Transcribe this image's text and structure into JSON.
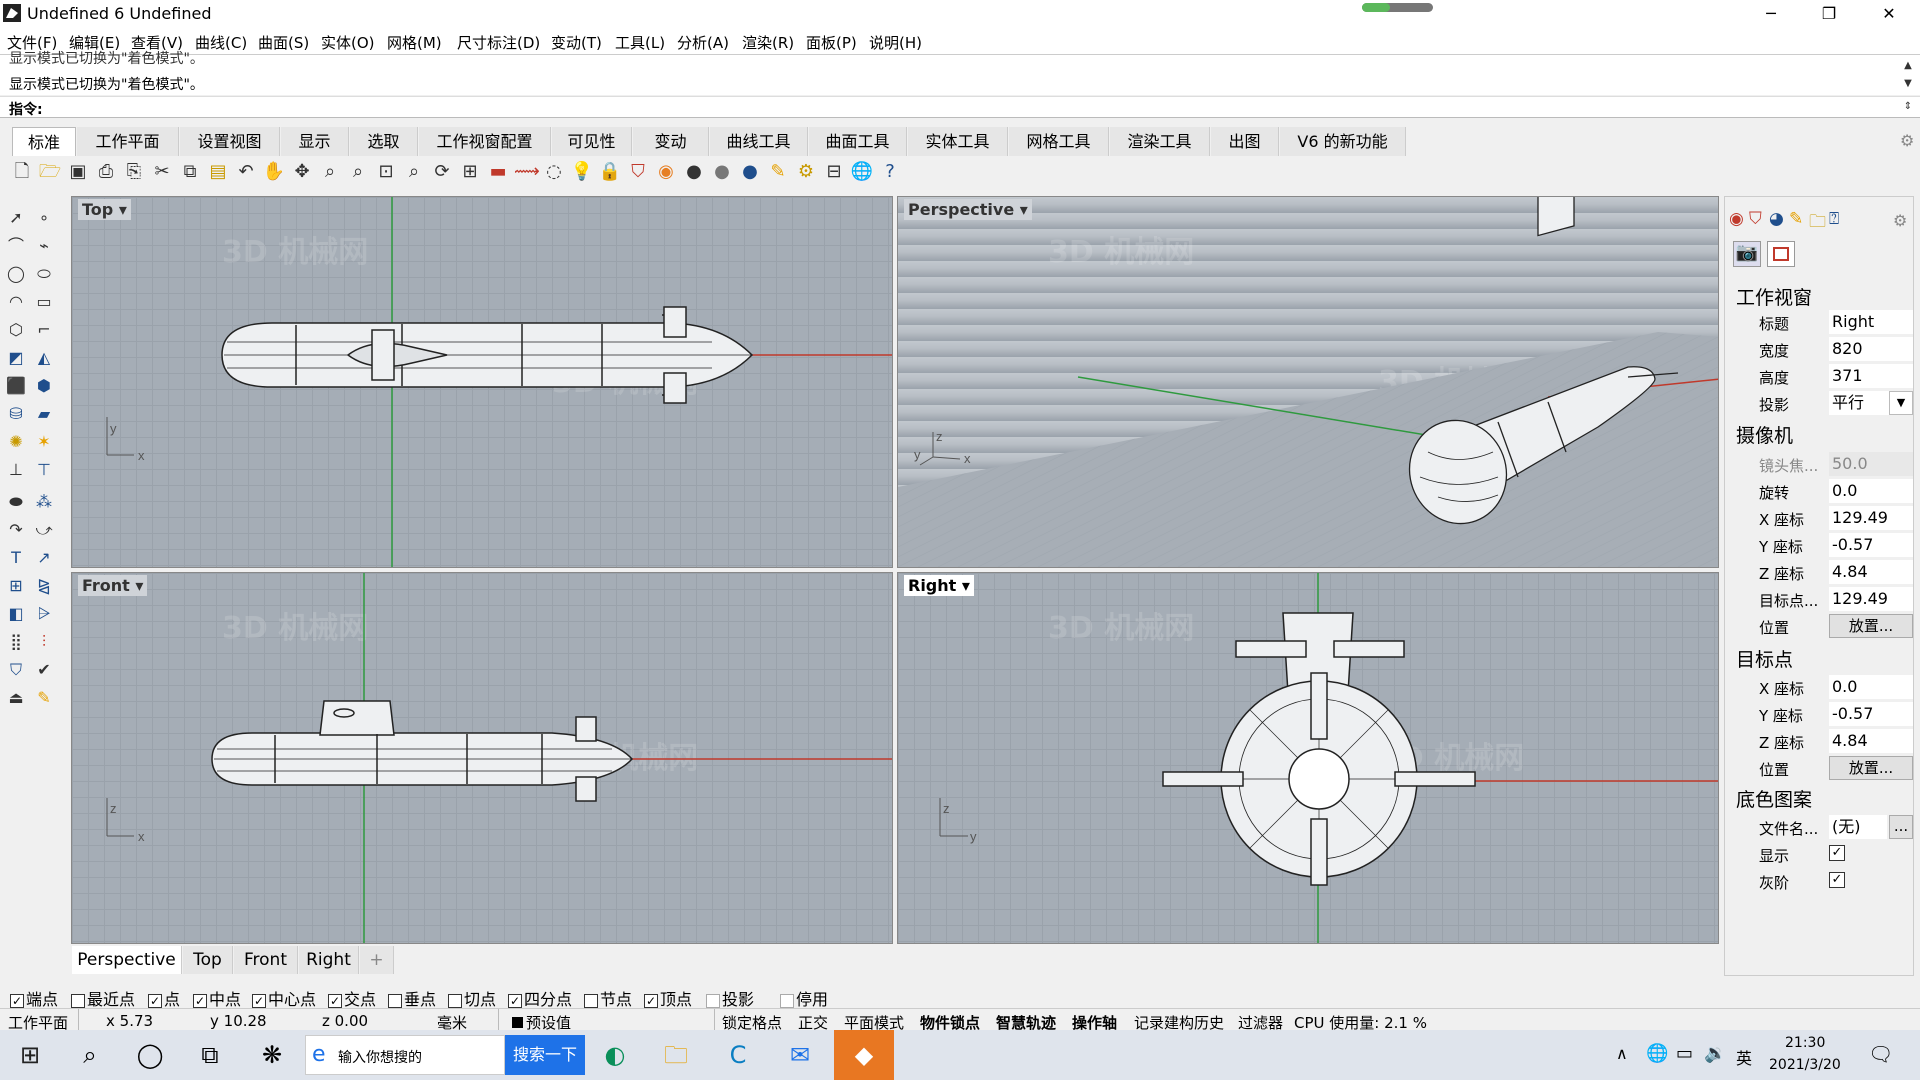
{
  "window": {
    "title": "Undefined 6 Undefined",
    "progress": 0.4,
    "minimize": "─",
    "restore": "❐",
    "close": "✕"
  },
  "menu": [
    "文件(F)",
    "编辑(E)",
    "查看(V)",
    "曲线(C)",
    "曲面(S)",
    "实体(O)",
    "网格(M)",
    "尺寸标注(D)",
    "变动(T)",
    "工具(L)",
    "分析(A)",
    "渲染(R)",
    "面板(P)",
    "说明(H)"
  ],
  "command": {
    "history_1": "显示模式已切换为\"着色模式\"。",
    "history_2": "显示模式已切换为\"着色模式\"。",
    "prompt_label": "指令:"
  },
  "tabs": {
    "items": [
      "标准",
      "工作平面",
      "设置视图",
      "显示",
      "选取",
      "工作视窗配置",
      "可见性",
      "变动",
      "曲线工具",
      "曲面工具",
      "实体工具",
      "网格工具",
      "渲染工具",
      "出图",
      "V6 的新功能"
    ],
    "active": 0
  },
  "toolbar_icons": [
    "new-file-icon",
    "open-icon",
    "save-icon",
    "print-icon",
    "import-icon",
    "cut-icon",
    "copy-icon",
    "paste-icon",
    "undo-icon",
    "pan-icon",
    "move-icon",
    "zoom-icon",
    "zoom-window-icon",
    "zoom-extents-icon",
    "zoom-selected-icon",
    "rotate-view-icon",
    "four-viewports-icon",
    "car-icon",
    "pipe-icon",
    "circle-icon",
    "light-icon",
    "lock-icon",
    "shield-icon",
    "color-wheel-icon",
    "sphere-icon",
    "render-icon",
    "material-icon",
    "pencil-icon",
    "gear-icon",
    "layout-icon",
    "globe-icon",
    "help-icon"
  ],
  "viewports": {
    "top": {
      "label": "Top",
      "axis_1": "y",
      "axis_2": "x"
    },
    "perspective": {
      "label": "Perspective",
      "axis_1": "z",
      "axis_2": "y",
      "axis_3": "x"
    },
    "front": {
      "label": "Front",
      "axis_1": "z",
      "axis_2": "x"
    },
    "right": {
      "label": "Right",
      "axis_1": "z",
      "axis_2": "y"
    }
  },
  "viewport_tabs": {
    "items": [
      "Perspective",
      "Top",
      "Front",
      "Right"
    ],
    "add": "+"
  },
  "panel": {
    "viewport_heading": "工作视窗",
    "title_label": "标题",
    "title_value": "Right",
    "width_label": "宽度",
    "width_value": "820",
    "height_label": "高度",
    "height_value": "371",
    "projection_label": "投影",
    "projection_value": "平行",
    "camera_heading": "摄像机",
    "lens_label": "镜头焦...",
    "lens_value": "50.0",
    "rotation_label": "旋转",
    "rotation_value": "0.0",
    "cam_x_label": "X 座标",
    "cam_x_value": "129.49",
    "cam_y_label": "Y 座标",
    "cam_y_value": "-0.57",
    "cam_z_label": "Z 座标",
    "cam_z_value": "4.84",
    "target_dist_label": "目标点...",
    "target_dist_value": "129.49",
    "cam_position_label": "位置",
    "place_button": "放置...",
    "target_heading": "目标点",
    "tgt_x_label": "X 座标",
    "tgt_x_value": "0.0",
    "tgt_y_label": "Y 座标",
    "tgt_y_value": "-0.57",
    "tgt_z_label": "Z 座标",
    "tgt_z_value": "4.84",
    "tgt_position_label": "位置",
    "wallpaper_heading": "底色图案",
    "filename_label": "文件名...",
    "filename_value": "(无)",
    "browse_button": "...",
    "show_label": "显示",
    "gray_label": "灰阶",
    "check": "✓"
  },
  "osnap": [
    {
      "label": "端点",
      "checked": true
    },
    {
      "label": "最近点",
      "checked": false
    },
    {
      "label": "点",
      "checked": true
    },
    {
      "label": "中点",
      "checked": true
    },
    {
      "label": "中心点",
      "checked": true
    },
    {
      "label": "交点",
      "checked": true
    },
    {
      "label": "垂点",
      "checked": false
    },
    {
      "label": "切点",
      "checked": false
    },
    {
      "label": "四分点",
      "checked": true
    },
    {
      "label": "节点",
      "checked": false
    },
    {
      "label": "顶点",
      "checked": true
    },
    {
      "label": "投影",
      "checked": false
    },
    {
      "label": "停用",
      "checked": false
    }
  ],
  "status": {
    "cplane": "工作平面",
    "x": "x 5.73",
    "y": "y 10.28",
    "z": "z 0.00",
    "units": "毫米",
    "layer": "预设值",
    "grid_snap": "锁定格点",
    "ortho": "正交",
    "planar": "平面模式",
    "osnap": "物件锁点",
    "smarttrack": "智慧轨迹",
    "gumball": "操作轴",
    "history": "记录建构历史",
    "filter": "过滤器",
    "cpu": "CPU 使用量: 2.1 %"
  },
  "taskbar": {
    "search_placeholder": "输入你想搜的",
    "search_button": "搜索一下",
    "time": "21:30",
    "date": "2021/3/20",
    "ime": "英"
  },
  "colors": {
    "x_axis": "#c0392b",
    "y_axis": "#2e9a3e",
    "viewport_bg": "#a5adb6",
    "accent": "#1e72e8"
  }
}
